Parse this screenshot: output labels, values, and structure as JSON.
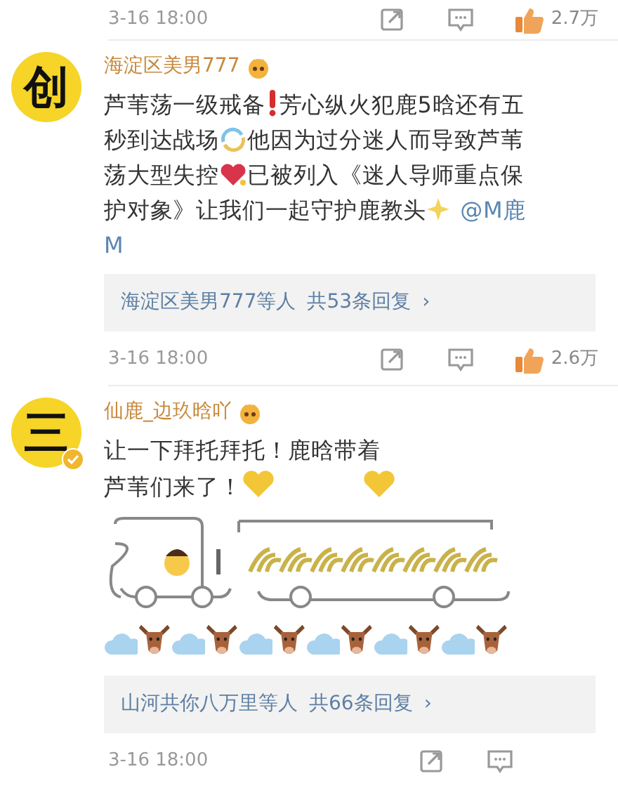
{
  "top_actions": {
    "time": "3-16 18:00",
    "likes": "2.7万"
  },
  "comments": [
    {
      "avatar": "创",
      "verified": false,
      "name": "海淀区美男777",
      "lines": [
        [
          {
            "kind": "text",
            "text": "芦苇荡一级戒备"
          },
          {
            "kind": "exclamation"
          },
          {
            "kind": "text",
            "text": "芳心纵火犯鹿5晗还有五"
          }
        ],
        [
          {
            "kind": "text",
            "text": "秒到达战场"
          },
          {
            "kind": "swirl"
          },
          {
            "kind": "text",
            "text": "他因为过分迷人而导致芦苇"
          }
        ],
        [
          {
            "kind": "text",
            "text": "荡大型失控"
          },
          {
            "kind": "heart"
          },
          {
            "kind": "text",
            "text": "已被列入《迷人导师重点保"
          }
        ],
        [
          {
            "kind": "text",
            "text": "护对象》让我们一起守护鹿教头"
          },
          {
            "kind": "sparkle"
          },
          {
            "kind": "link",
            "text": "@M鹿"
          }
        ],
        [
          {
            "kind": "link",
            "text": "M"
          }
        ]
      ],
      "replies": {
        "who": "海淀区美男777等人",
        "count": "共53条回复",
        "arrow": "›"
      },
      "time": "3-16 18:00",
      "likes": "2.6万"
    },
    {
      "avatar": "三",
      "verified": true,
      "name": "仙鹿_边玖晗吖",
      "lines": [
        [
          {
            "kind": "text",
            "text": "让一下拜托拜托！鹿晗带着"
          }
        ],
        [
          {
            "kind": "text",
            "text": "芦苇们来了！"
          },
          {
            "kind": "goldheart"
          },
          {
            "kind": "spacer"
          },
          {
            "kind": "goldheart"
          }
        ],
        [
          {
            "kind": "truck"
          }
        ],
        [
          {
            "kind": "cloud"
          },
          {
            "kind": "cow"
          },
          {
            "kind": "cloud"
          },
          {
            "kind": "cow"
          },
          {
            "kind": "cloud"
          },
          {
            "kind": "cow"
          },
          {
            "kind": "cloud"
          },
          {
            "kind": "cow"
          },
          {
            "kind": "cloud"
          },
          {
            "kind": "cow"
          },
          {
            "kind": "cloud"
          },
          {
            "kind": "cow"
          }
        ]
      ],
      "replies": {
        "who": "山河共你八万里等人",
        "count": "共66条回复",
        "arrow": "›"
      },
      "time": "3-16 18:00"
    }
  ]
}
